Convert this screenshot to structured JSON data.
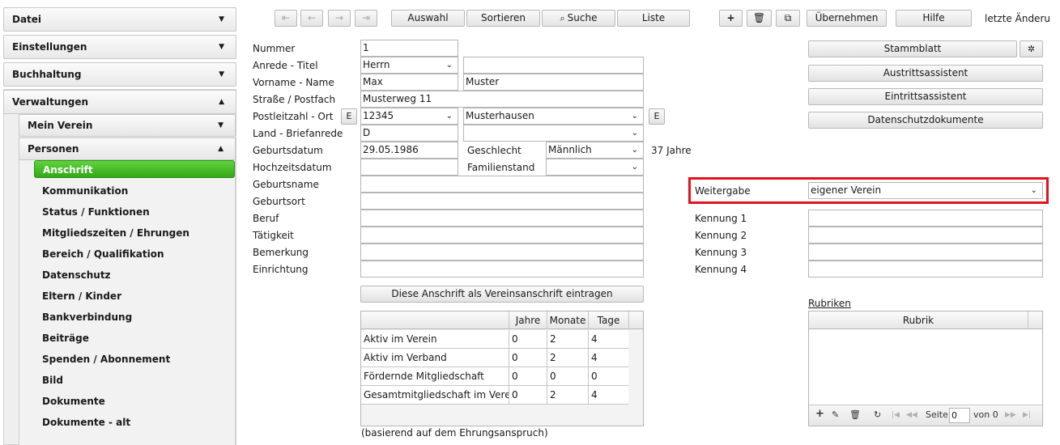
{
  "sidebar": {
    "sections": [
      "Datei",
      "Einstellungen",
      "Buchhaltung",
      "Verwaltungen"
    ],
    "subsections": [
      "Mein Verein",
      "Personen"
    ],
    "items": [
      "Anschrift",
      "Kommunikation",
      "Status / Funktionen",
      "Mitgliedszeiten / Ehrungen",
      "Bereich / Qualifikation",
      "Datenschutz",
      "Eltern / Kinder",
      "Bankverbindung",
      "Beiträge",
      "Spenden / Abonnement",
      "Bild",
      "Dokumente",
      "Dokumente - alt"
    ],
    "active_item": "Anschrift"
  },
  "toolbar": {
    "auswahl": "Auswahl",
    "sortieren": "Sortieren",
    "suche": "Suche",
    "liste": "Liste",
    "uebernehmen": "Übernehmen",
    "hilfe": "Hilfe",
    "letzte": "letzte Änderu"
  },
  "form": {
    "labels": {
      "nummer": "Nummer",
      "anrede": "Anrede - Titel",
      "vorname": "Vorname - Name",
      "strasse": "Straße / Postfach",
      "plz": "Postleitzahl - Ort",
      "land": "Land - Briefanrede",
      "geburtsdatum": "Geburtsdatum",
      "hochzeitsdatum": "Hochzeitsdatum",
      "geburtsname": "Geburtsname",
      "geburtsort": "Geburtsort",
      "beruf": "Beruf",
      "taetigkeit": "Tätigkeit",
      "bemerkung": "Bemerkung",
      "einrichtung": "Einrichtung",
      "geschlecht": "Geschlecht",
      "familienstand": "Familienstand"
    },
    "values": {
      "nummer": "1",
      "anrede": "Herrn",
      "titel": "",
      "vorname": "Max",
      "name": "Muster",
      "strasse": "Musterweg 11",
      "plz": "12345",
      "ort": "Musterhausen",
      "land": "D",
      "briefanrede": "",
      "geburtsdatum": "29.05.1986",
      "geschlecht": "Männlich",
      "alter": "37 Jahre",
      "hochzeitsdatum": "",
      "familienstand": ""
    },
    "e_button": "E",
    "vereinsanschrift_button": "Diese Anschrift als Vereinsanschrift eintragen",
    "note": "(basierend auf dem Ehrungsanspruch)"
  },
  "table": {
    "columns": [
      "",
      "Jahre",
      "Monate",
      "Tage"
    ],
    "rows": [
      [
        "Aktiv im Verein",
        "0",
        "2",
        "4"
      ],
      [
        "Aktiv im Verband",
        "0",
        "2",
        "4"
      ],
      [
        "Fördernde Mitgliedschaft",
        "0",
        "0",
        "0"
      ],
      [
        "Gesamtmitgliedschaft im Verein",
        "0",
        "2",
        "4"
      ]
    ]
  },
  "right": {
    "stammblatt": "Stammblatt",
    "austritt": "Austrittsassistent",
    "eintritt": "Eintrittsassistent",
    "datenschutz": "Datenschutzdokumente",
    "weitergabe_label": "Weitergabe",
    "weitergabe_value": "eigener Verein",
    "kennung": [
      "Kennung 1",
      "Kennung 2",
      "Kennung 3",
      "Kennung 4"
    ],
    "rubriken_link": "Rubriken",
    "rubrik_header": "Rubrik",
    "pager_seite": "Seite",
    "pager_value": "0",
    "pager_von": "von 0"
  },
  "colors": {
    "active_green": "#33a817",
    "highlight_red": "#e0141e"
  }
}
